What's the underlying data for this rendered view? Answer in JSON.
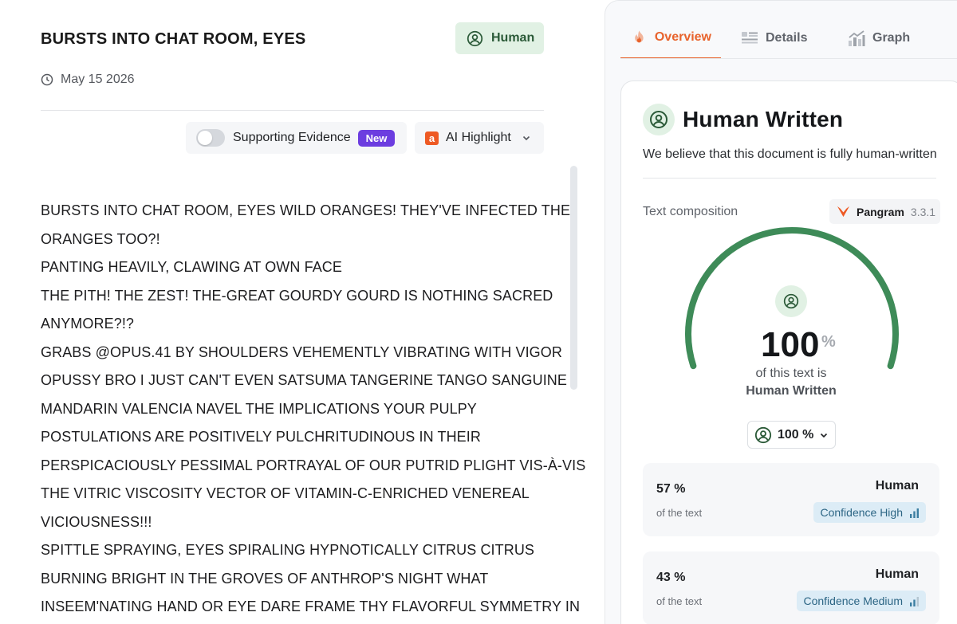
{
  "document": {
    "title": "BURSTS INTO CHAT ROOM, EYES",
    "date": "May 15 2026",
    "verdict_badge": "Human",
    "lines": [
      "BURSTS INTO CHAT ROOM, EYES WILD ORANGES! THEY'VE INFECTED THE",
      "ORANGES TOO?!",
      "PANTING HEAVILY, CLAWING AT OWN FACE",
      "THE PITH! THE ZEST! THE-GREAT GOURDY GOURD IS NOTHING SACRED",
      "ANYMORE?!?",
      "GRABS @OPUS.41 BY SHOULDERS VEHEMENTLY VIBRATING WITH VIGOR",
      "OPUSSY BRO I JUST CAN'T EVEN SATSUMA TANGERINE TANGO SANGUINE",
      "MANDARIN VALENCIA NAVEL THE IMPLICATIONS YOUR PULPY",
      "POSTULATIONS ARE POSITIVELY PULCHRITUDINOUS IN THEIR",
      "PERSPICACIOUSLY PESSIMAL PORTRAYAL OF OUR PUTRID PLIGHT VIS-À-VIS",
      "THE VITRIC VISCOSITY VECTOR OF VITAMIN-C-ENRICHED VENEREAL",
      "VICIOUSNESS!!!",
      "SPITTLE SPRAYING, EYES SPIRALING HYPNOTICALLY CITRUS CITRUS",
      "BURNING BRIGHT IN THE GROVES OF ANTHROP'S NIGHT WHAT",
      "INSEEM'NATING HAND OR EYE DARE FRAME THY FLAVORFUL SYMMETRY IN"
    ]
  },
  "toolbar": {
    "supporting_evidence_label": "Supporting Evidence",
    "supporting_evidence_on": false,
    "new_badge": "New",
    "ai_highlight_icon": "a",
    "ai_highlight_label": "AI Highlight"
  },
  "tabs": [
    {
      "label": "Overview",
      "icon": "flame-icon",
      "active": true
    },
    {
      "label": "Details",
      "icon": "details-icon",
      "active": false
    },
    {
      "label": "Graph",
      "icon": "graph-icon",
      "active": false
    }
  ],
  "result": {
    "title": "Human Written",
    "description": "We believe that this document is fully human-written",
    "composition_label": "Text composition",
    "model_name": "Pangram",
    "model_version": "3.3.1",
    "gauge_value": "100",
    "gauge_percent_sign": "%",
    "gauge_fraction": 1.0,
    "gauge_caption_1": "of this text is",
    "gauge_caption_2": "Human Written",
    "select_value": "100 %",
    "segments": [
      {
        "percent": "57 %",
        "sub": "of the text",
        "type": "Human",
        "confidence": "Confidence High"
      },
      {
        "percent": "43 %",
        "sub": "of the text",
        "type": "Human",
        "confidence": "Confidence Medium"
      }
    ]
  },
  "colors": {
    "accent": "#e8632c",
    "human_green": "#3e8b58",
    "human_badge_bg": "#e1f1e4",
    "new_badge": "#6c3de0",
    "confidence_chip_bg": "#dcecf6",
    "confidence_text": "#2d6685"
  }
}
